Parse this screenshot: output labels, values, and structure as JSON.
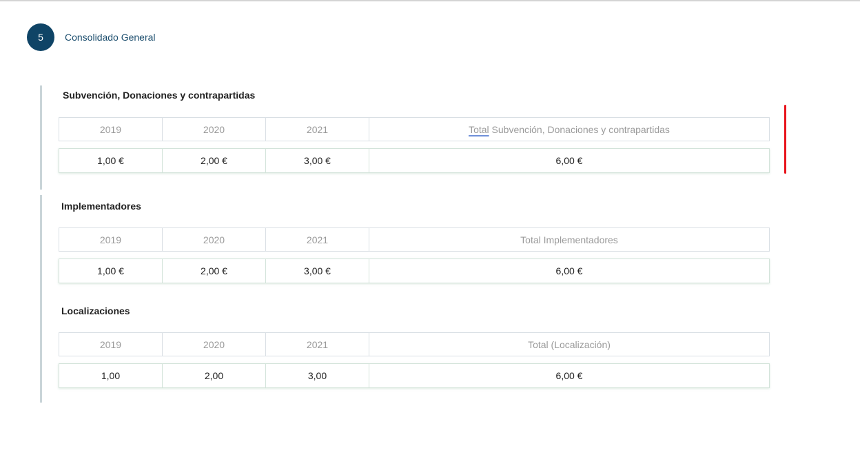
{
  "header": {
    "step_number": "5",
    "step_title": "Consolidado General"
  },
  "sections": [
    {
      "title": "Subvención, Donaciones y contrapartidas",
      "columns": [
        "2019",
        "2020",
        "2021"
      ],
      "total_header_prefix": "Total",
      "total_header_rest": " Subvención, Donaciones y contrapartidas",
      "values": [
        "1,00 €",
        "2,00 €",
        "3,00 €",
        "6,00 €"
      ]
    },
    {
      "title": "Implementadores",
      "columns": [
        "2019",
        "2020",
        "2021"
      ],
      "total_header": "Total Implementadores",
      "values": [
        "1,00 €",
        "2,00 €",
        "3,00 €",
        "6,00 €"
      ]
    },
    {
      "title": "Localizaciones",
      "columns": [
        "2019",
        "2020",
        "2021"
      ],
      "total_header": "Total (Localización)",
      "values": [
        "1,00",
        "2,00",
        "3,00",
        "6,00 €"
      ]
    }
  ],
  "colors": {
    "badge": "#0f4466",
    "accent_line": "#1f4e5f",
    "annotation": "#e8141c"
  }
}
